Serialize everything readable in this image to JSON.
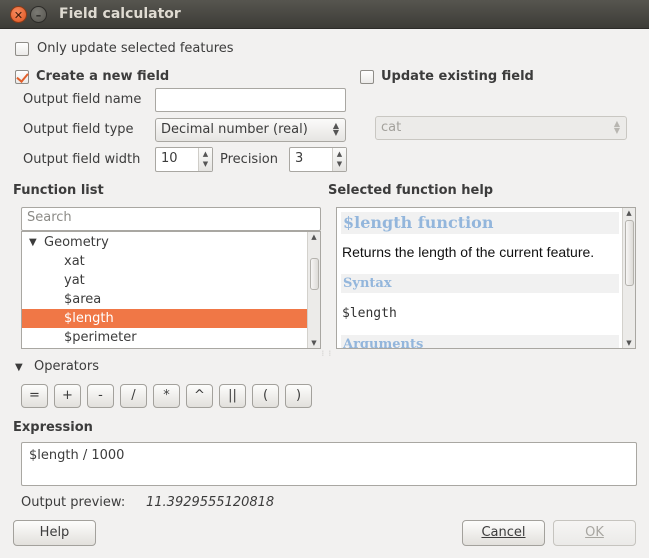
{
  "window": {
    "title": "Field calculator",
    "close_glyph": "✕",
    "minimize_glyph": "–"
  },
  "options": {
    "only_selected_label": "Only update selected features",
    "only_selected_checked": false,
    "create_new_label": "Create a new field",
    "create_new_checked": true,
    "update_existing_label": "Update existing field",
    "update_existing_checked": false
  },
  "new_field": {
    "name_label": "Output field name",
    "name_value": "",
    "type_label": "Output field type",
    "type_value": "Decimal number (real)",
    "width_label": "Output field width",
    "width_value": "10",
    "precision_label": "Precision",
    "precision_value": "3"
  },
  "existing_field": {
    "selected": "cat"
  },
  "function_list": {
    "label": "Function list",
    "search_placeholder": "Search",
    "group": "Geometry",
    "items": [
      "xat",
      "yat",
      "$area",
      "$length",
      "$perimeter"
    ],
    "selected_index": 3
  },
  "help": {
    "label": "Selected function help",
    "title": "$length function",
    "description": "Returns the length of the current feature.",
    "syntax_heading": "Syntax",
    "syntax": "$length",
    "arguments_heading": "Arguments"
  },
  "operators": {
    "label": "Operators",
    "buttons": [
      "=",
      "+",
      "-",
      "/",
      "*",
      "^",
      "||",
      "(",
      ")"
    ]
  },
  "expression": {
    "label": "Expression",
    "value": "$length / 1000"
  },
  "preview": {
    "label": "Output preview:",
    "value": "11.3929555120818"
  },
  "buttons": {
    "help": "Help",
    "cancel": "Cancel",
    "ok": "OK"
  },
  "colors": {
    "accent": "#f07746",
    "help_heading": "#93b6dc",
    "titlebar": "#3d3c37"
  }
}
